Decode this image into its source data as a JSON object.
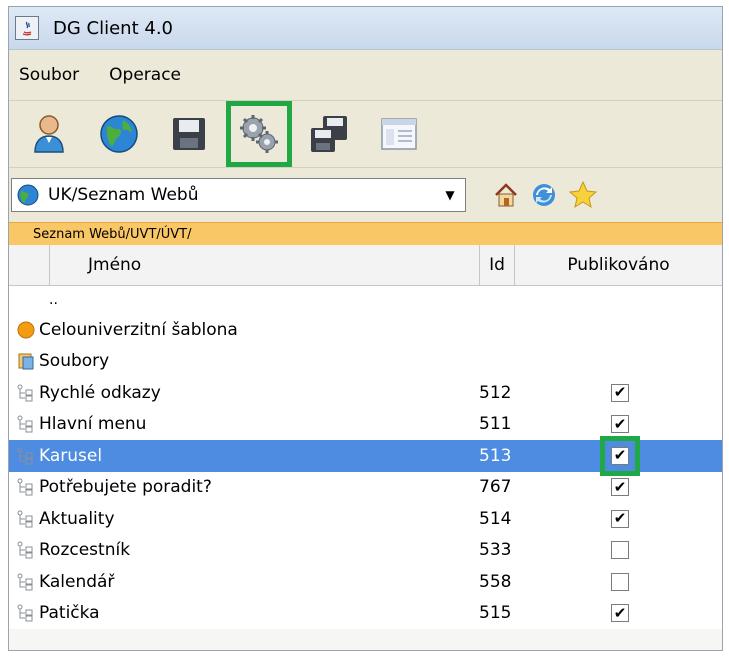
{
  "window": {
    "title": "DG Client 4.0"
  },
  "menu": {
    "items": [
      {
        "label": "Soubor"
      },
      {
        "label": "Operace"
      }
    ]
  },
  "toolbar": {
    "tools": [
      {
        "icon": "user-icon"
      },
      {
        "icon": "globe-icon"
      },
      {
        "icon": "save-icon"
      },
      {
        "icon": "gears-icon",
        "highlighted": true
      },
      {
        "icon": "save-multiple-icon"
      },
      {
        "icon": "window-list-icon"
      }
    ],
    "highlight_color": "#1fa843"
  },
  "nav": {
    "combo_value": "UK/Seznam Webů"
  },
  "breadcrumb": {
    "path": "Seznam Webů/UVT/ÚVT/"
  },
  "table": {
    "columns": {
      "name": "Jméno",
      "id": "Id",
      "published": "Publikováno"
    },
    "parent_row": "..",
    "rows": [
      {
        "name": "Celouniverzitní šablona",
        "icon": "template-icon",
        "id": "",
        "published": null,
        "selected": false
      },
      {
        "name": "Soubory",
        "icon": "files-icon",
        "id": "",
        "published": null,
        "selected": false
      },
      {
        "name": "Rychlé odkazy",
        "icon": "tree-node-icon",
        "id": "512",
        "published": true,
        "selected": false
      },
      {
        "name": "Hlavní menu",
        "icon": "tree-node-icon",
        "id": "511",
        "published": true,
        "selected": false
      },
      {
        "name": "Karusel",
        "icon": "tree-node-icon",
        "id": "513",
        "published": true,
        "selected": true
      },
      {
        "name": "Potřebujete poradit?",
        "icon": "tree-node-icon",
        "id": "767",
        "published": true,
        "selected": false
      },
      {
        "name": "Aktuality",
        "icon": "tree-node-icon",
        "id": "514",
        "published": true,
        "selected": false
      },
      {
        "name": "Rozcestník",
        "icon": "tree-node-icon",
        "id": "533",
        "published": false,
        "selected": false
      },
      {
        "name": "Kalendář",
        "icon": "tree-node-icon",
        "id": "558",
        "published": false,
        "selected": false
      },
      {
        "name": "Patička",
        "icon": "tree-node-icon",
        "id": "515",
        "published": true,
        "selected": false
      }
    ]
  },
  "colors": {
    "selection": "#4d8ce0",
    "breadcrumb_bg": "#f9c766"
  }
}
